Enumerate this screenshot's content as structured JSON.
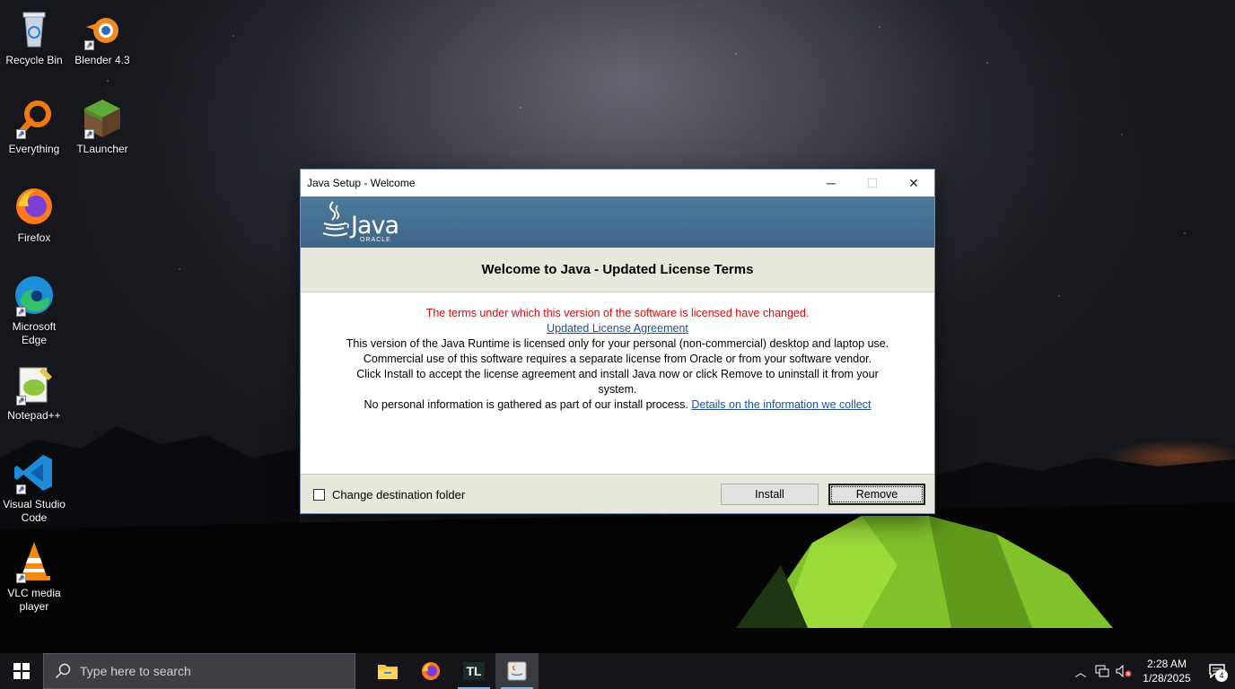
{
  "desktop": {
    "icons": [
      {
        "label": "Recycle Bin"
      },
      {
        "label": "Blender 4.3"
      },
      {
        "label": "Everything"
      },
      {
        "label": "TLauncher"
      },
      {
        "label": "Firefox"
      },
      {
        "label": "Microsoft Edge"
      },
      {
        "label": "Notepad++"
      },
      {
        "label": "Visual Studio Code"
      },
      {
        "label": "VLC media player"
      }
    ]
  },
  "dialog": {
    "title": "Java Setup - Welcome",
    "logo_text": "Java",
    "logo_sub": "ORACLE",
    "heading": "Welcome to Java - Updated License Terms",
    "warning": "The terms under which this version of the software is licensed have changed.",
    "license_link": "Updated License Agreement",
    "para1": "This version of the Java Runtime is licensed only for your personal (non-commercial) desktop and laptop use.",
    "para2": "Commercial use of this software requires a separate license from Oracle or from your software vendor.",
    "para3": "Click Install to accept the license agreement and install Java now or click Remove to uninstall it from your system.",
    "para4": "No personal information is gathered as part of our install process.",
    "details_link": "Details on the information we collect",
    "checkbox_label": "Change destination folder",
    "checkbox_checked": false,
    "install_label": "Install",
    "remove_label": "Remove"
  },
  "taskbar": {
    "search_placeholder": "Type here to search",
    "pinned": [
      "file-explorer",
      "firefox",
      "tlauncher",
      "java-setup"
    ],
    "tl_label": "TL",
    "time": "2:28 AM",
    "date": "1/28/2025",
    "notification_count": "4",
    "accent": "#76b9ed"
  }
}
